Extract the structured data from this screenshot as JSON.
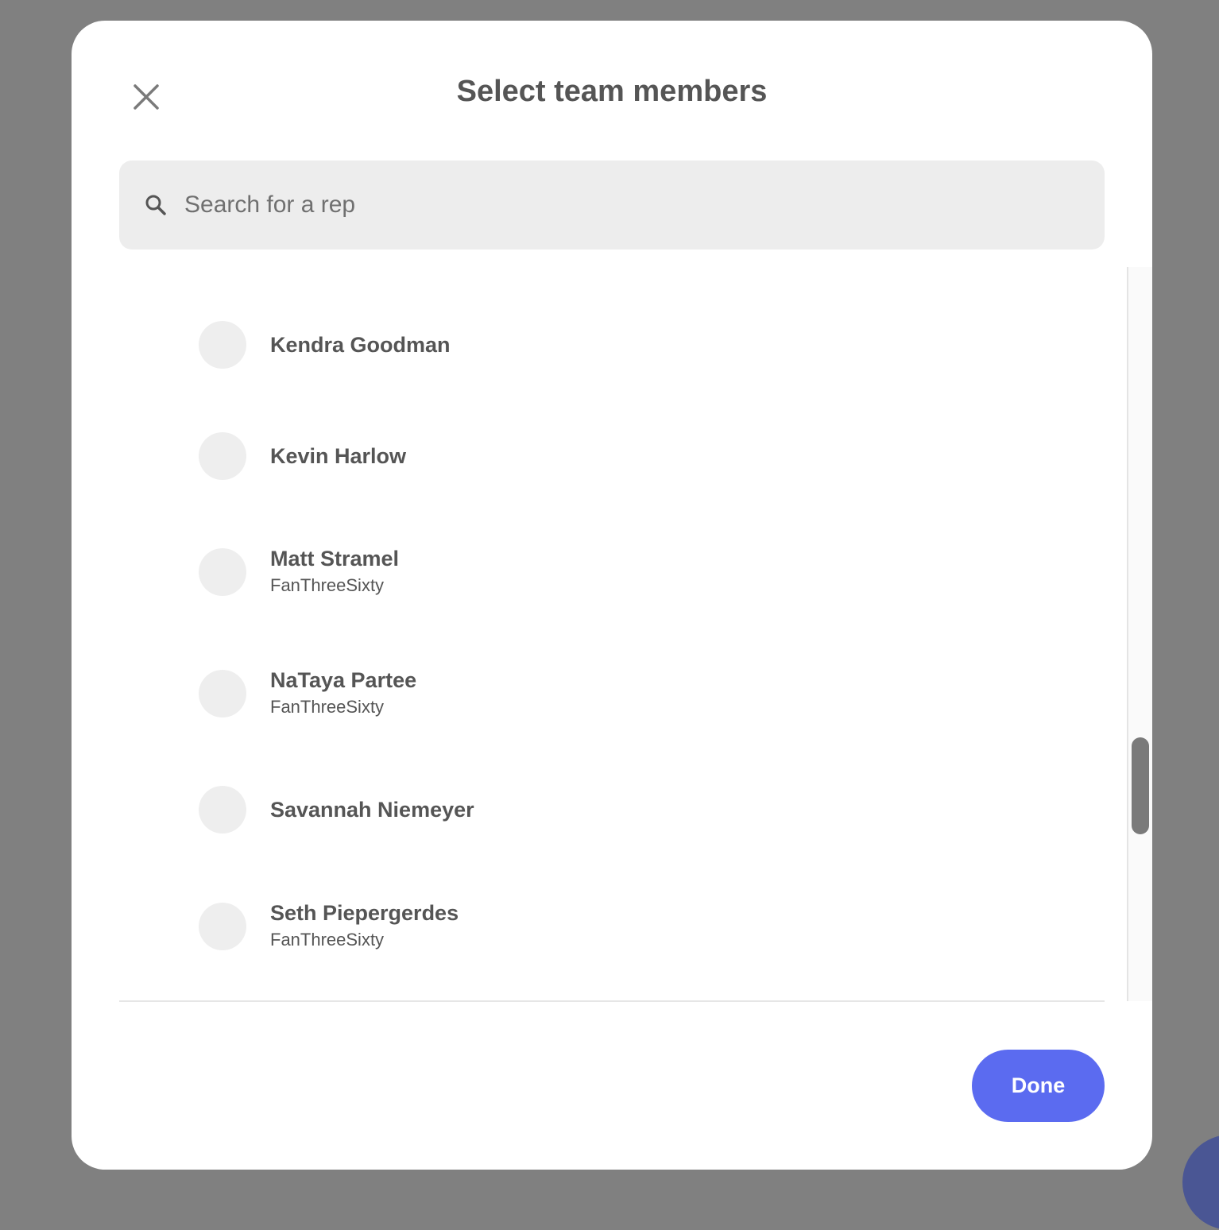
{
  "modal": {
    "title": "Select team members"
  },
  "search": {
    "placeholder": "Search for a rep",
    "value": ""
  },
  "members": [
    {
      "name": "Kendra Goodman",
      "org": ""
    },
    {
      "name": "Kevin Harlow",
      "org": ""
    },
    {
      "name": "Matt Stramel",
      "org": "FanThreeSixty"
    },
    {
      "name": "NaTaya Partee",
      "org": "FanThreeSixty"
    },
    {
      "name": "Savannah Niemeyer",
      "org": ""
    },
    {
      "name": "Seth Piepergerdes",
      "org": "FanThreeSixty"
    }
  ],
  "footer": {
    "done_label": "Done"
  },
  "colors": {
    "accent": "#5b6bf0",
    "overlay": "#808080",
    "text": "#555555"
  },
  "icons": {
    "close": "close-icon",
    "search": "search-icon"
  }
}
